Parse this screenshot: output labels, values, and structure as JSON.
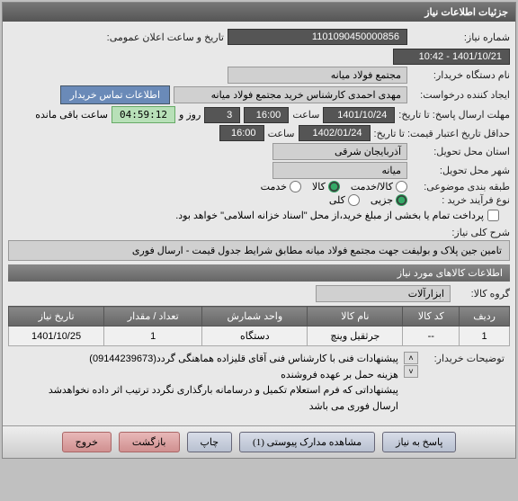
{
  "header": {
    "title": "جزئیات اطلاعات نیاز"
  },
  "info": {
    "needNoLabel": "شماره نیاز:",
    "needNo": "1101090450000856",
    "dateLabel": "تاریخ و ساعت اعلان عمومی:",
    "date": "1401/10/21 - 10:42",
    "buyerLabel": "نام دستگاه خریدار:",
    "buyer": "مجتمع فولاد میانه",
    "creatorLabel": "ایجاد کننده درخواست:",
    "creator": "مهدی احمدی کارشناس خرید مجتمع فولاد میانه",
    "contactBtn": "اطلاعات تماس خریدار",
    "deadlineLabel": "مهلت ارسال پاسخ: تا تاریخ:",
    "deadlineDate": "1401/10/24",
    "timeLabel": "ساعت",
    "deadlineTime": "16:00",
    "dayLabel": "روز و",
    "days": "3",
    "remainTime": "04:59:12",
    "remainLabel": "ساعت باقی مانده",
    "validityLabel": "حداقل تاریخ اعتبار قیمت: تا تاریخ:",
    "validityDate": "1402/01/24",
    "validityTime": "16:00",
    "provinceLabel": "استان محل تحویل:",
    "province": "آذربایجان شرقی",
    "cityLabel": "شهر محل تحویل:",
    "city": "میانه",
    "categoryLabel": "طبقه بندی موضوعی:",
    "cat1": "کالا/خدمت",
    "cat2": "کالا",
    "cat3": "خدمت",
    "buyTypeLabel": "نوع فرآیند خرید :",
    "buyType1": "جزیی",
    "buyType2": "کلی",
    "payNote": "پرداخت تمام یا بخشی از مبلغ خرید،از محل \"اسناد خزانه اسلامی\" خواهد بود.",
    "descLabel": "شرح کلی نیاز:",
    "desc": "تامین جین پلاک و بولیفت  جهت مجتمع فولاد میانه مطابق شرایط جدول قیمت - ارسال فوری"
  },
  "goods": {
    "title": "اطلاعات کالاهای مورد نیاز",
    "groupLabel": "گروه کالا:",
    "group": "ابزارآلات",
    "cols": {
      "row": "ردیف",
      "code": "کد کالا",
      "name": "نام کالا",
      "unit": "واحد شمارش",
      "qty": "تعداد / مقدار",
      "date": "تاریخ نیاز"
    },
    "items": [
      {
        "row": "1",
        "code": "--",
        "name": "جرثقیل وینچ",
        "unit": "دستگاه",
        "qty": "1",
        "date": "1401/10/25"
      }
    ],
    "notesLabel": "توضیحات خریدار:",
    "notes": "پیشنهادات فنی با کارشناس فنی آقای قلیزاده هماهنگی گردد(09144239673)\nهزینه حمل بر عهده فروشنده\nپیشنهاداتی که فرم استعلام تکمیل و درسامانه بارگذاری نگردد ترتیب اثر داده نخواهدشد\nارسال فوری می باشد"
  },
  "footer": {
    "reply": "پاسخ به نیاز",
    "attach": "مشاهده مدارک پیوستی (1)",
    "print": "چاپ",
    "back": "بازگشت",
    "exit": "خروج"
  }
}
